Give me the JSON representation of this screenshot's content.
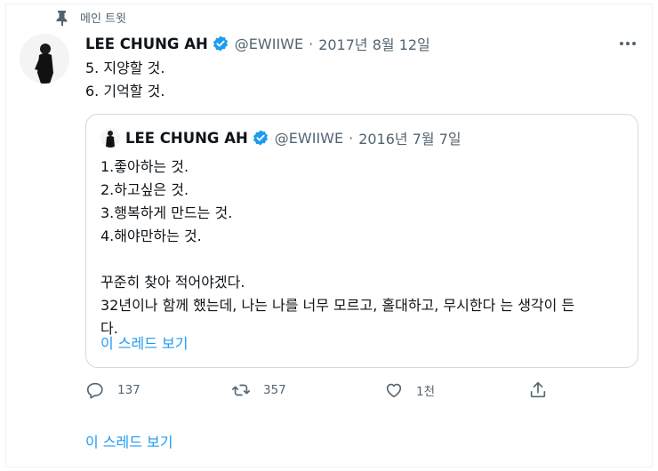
{
  "pinned": {
    "label": "메인 트윗",
    "icon": "pin-icon"
  },
  "tweet": {
    "name": "LEE CHUNG AH",
    "handle": "@EWIIWE",
    "separator": "·",
    "date": "2017년 8월 12일",
    "lines": [
      "5. 지양할 것.",
      "6. 기억할 것."
    ]
  },
  "quote": {
    "name": "LEE CHUNG AH",
    "handle": "@EWIIWE",
    "separator": "·",
    "date": "2016년 7월 7일",
    "lines": [
      "1.좋아하는 것.",
      "2.하고싶은 것.",
      "3.행복하게 만드는 것.",
      "4.해야만하는 것.",
      "",
      "꾸준히 찾아 적어야겠다.",
      "32년이나 함께 했는데, 나는 나를 너무 모르고, 홀대하고, 무시한다 는 생각이 든",
      "다."
    ],
    "show_thread": "이 스레드 보기"
  },
  "actions": {
    "reply_count": "137",
    "retweet_count": "357",
    "like_count": "1천"
  },
  "thread_link": "이 스레드 보기",
  "colors": {
    "accent": "#1d9bf0",
    "muted": "#536471",
    "border": "#cfd9de",
    "text": "#0f1419"
  }
}
